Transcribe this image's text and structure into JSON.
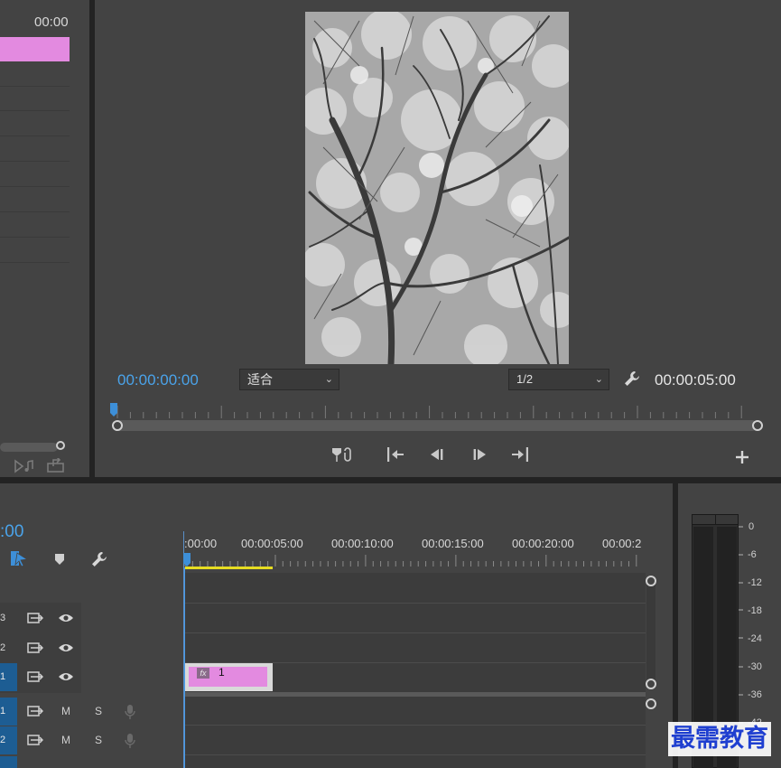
{
  "source_panel": {
    "timecode": "00:00",
    "clip_color": "#e38ae0"
  },
  "program_monitor": {
    "current_timecode": "00:00:00:00",
    "fit_dropdown": {
      "label": "适合"
    },
    "resolution_dropdown": {
      "label": "1/2"
    },
    "duration_timecode": "00:00:05:00",
    "playhead_progress": 0
  },
  "transport": {
    "buttons": [
      "add-marker",
      "go-to-in",
      "step-back",
      "step-forward",
      "go-to-out",
      "add"
    ]
  },
  "timeline": {
    "timecode_partial": ":00",
    "ruler_labels": [
      ":00:00",
      "00:00:05:00",
      "00:00:10:00",
      "00:00:15:00",
      "00:00:20:00",
      "00:00:2"
    ],
    "video_tracks": [
      {
        "label": "3"
      },
      {
        "label": "2"
      },
      {
        "label": "1"
      }
    ],
    "audio_tracks": [
      {
        "label": "1",
        "mute": "M",
        "solo": "S"
      },
      {
        "label": "2",
        "mute": "M",
        "solo": "S"
      }
    ],
    "clip": {
      "fx": "fx",
      "name": "1",
      "color": "#e38ae0"
    }
  },
  "audio_meter": {
    "scale": [
      "0",
      "-6",
      "-12",
      "-18",
      "-24",
      "-30",
      "-36",
      "-42"
    ]
  },
  "watermark": "最需教育"
}
